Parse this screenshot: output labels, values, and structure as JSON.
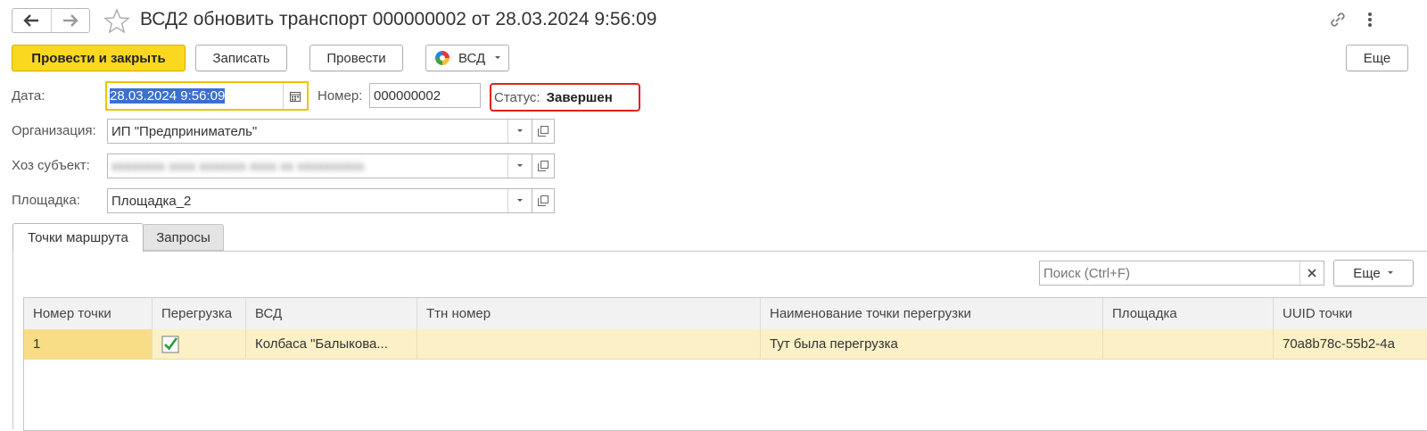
{
  "header": {
    "title": "ВСД2 обновить транспорт 000000002 от 28.03.2024 9:56:09"
  },
  "toolbar": {
    "post_close": "Провести и закрыть",
    "save": "Записать",
    "post": "Провести",
    "vsd": "ВСД",
    "more": "Еще"
  },
  "form": {
    "date_label": "Дата:",
    "date_value": "28.03.2024  9:56:09",
    "number_label": "Номер:",
    "number_value": "000000002",
    "status_label": "Статус:",
    "status_value": "Завершен",
    "org_label": "Организация:",
    "org_value": "ИП \"Предприниматель\"",
    "subject_label": "Хоз субъект:",
    "subject_value": "хххххххх хххх ххххххх хххх хх хххххххххх",
    "site_label": "Площадка:",
    "site_value": "Площадка_2"
  },
  "tabs": [
    {
      "label": "Точки маршрута",
      "active": true
    },
    {
      "label": "Запросы",
      "active": false
    }
  ],
  "search": {
    "placeholder": "Поиск (Ctrl+F)",
    "more": "Еще"
  },
  "table": {
    "columns": [
      "Номер точки",
      "Перегрузка",
      "ВСД",
      "Ттн номер",
      "Наименование точки перегрузки",
      "Площадка",
      "UUID точки"
    ],
    "rows": [
      {
        "num": "1",
        "overload": true,
        "vsd": "Колбаса \"Балыкова...",
        "ttn": "",
        "name": "Тут была перегрузка",
        "site": "",
        "uuid": "70a8b78c-55b2-4a"
      }
    ]
  },
  "colors": {
    "primary": "#fbd820",
    "status_highlight": "#e02020",
    "row_selected": "#fbf0c6",
    "check": "#2a9d3a"
  }
}
